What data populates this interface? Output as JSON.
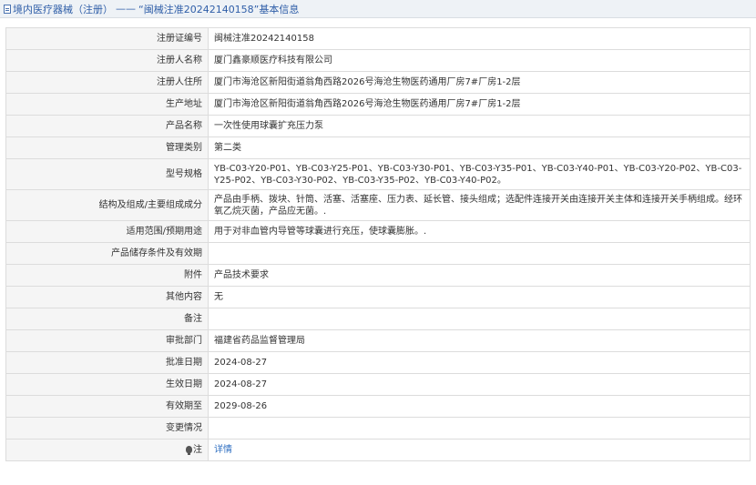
{
  "breadcrumb": {
    "section": "境内医疗器械（注册）",
    "separator": "——",
    "title": "“闽械注准20242140158”基本信息"
  },
  "rows": [
    {
      "label": "注册证编号",
      "value": "闽械注准20242140158"
    },
    {
      "label": "注册人名称",
      "value": "厦门鑫豪顺医疗科技有限公司"
    },
    {
      "label": "注册人住所",
      "value": "厦门市海沧区新阳街道翁角西路2026号海沧生物医药通用厂房7#厂房1-2层"
    },
    {
      "label": "生产地址",
      "value": "厦门市海沧区新阳街道翁角西路2026号海沧生物医药通用厂房7#厂房1-2层"
    },
    {
      "label": "产品名称",
      "value": "一次性使用球囊扩充压力泵"
    },
    {
      "label": "管理类别",
      "value": "第二类"
    },
    {
      "label": "型号规格",
      "value": "YB-C03-Y20-P01、YB-C03-Y25-P01、YB-C03-Y30-P01、YB-C03-Y35-P01、YB-C03-Y40-P01、YB-C03-Y20-P02、YB-C03-Y25-P02、YB-C03-Y30-P02、YB-C03-Y35-P02、YB-C03-Y40-P02。"
    },
    {
      "label": "结构及组成/主要组成成分",
      "value": "产品由手柄、拨块、针筒、活塞、活塞座、压力表、延长管、接头组成；选配件连接开关由连接开关主体和连接开关手柄组成。经环氧乙烷灭菌，产品应无菌。."
    },
    {
      "label": "适用范围/预期用途",
      "value": "用于对非血管内导管等球囊进行充压，使球囊膨胀。."
    },
    {
      "label": "产品储存条件及有效期",
      "value": ""
    },
    {
      "label": "附件",
      "value": "产品技术要求"
    },
    {
      "label": "其他内容",
      "value": "无"
    },
    {
      "label": "备注",
      "value": ""
    },
    {
      "label": "审批部门",
      "value": "福建省药品监督管理局"
    },
    {
      "label": "批准日期",
      "value": "2024-08-27"
    },
    {
      "label": "生效日期",
      "value": "2024-08-27"
    },
    {
      "label": "有效期至",
      "value": "2029-08-26"
    },
    {
      "label": "变更情况",
      "value": ""
    }
  ],
  "note": {
    "label": "注",
    "link_text": "详情"
  }
}
